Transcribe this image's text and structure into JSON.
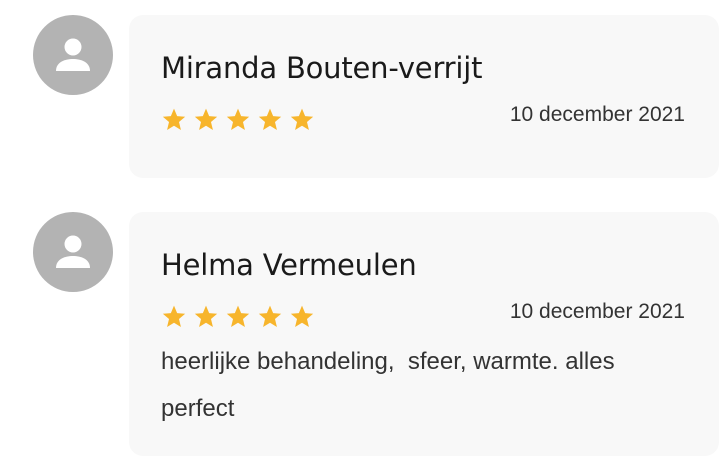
{
  "reviews": [
    {
      "author": "Miranda Bouten-verrijt",
      "rating": 5,
      "date": "10 december 2021",
      "text": "",
      "avatar_icon": "user-icon"
    },
    {
      "author": "Helma Vermeulen",
      "rating": 5,
      "date": "10 december 2021",
      "text": "heerlijke behandeling,  sfeer, warmte. alles perfect",
      "avatar_icon": "user-icon"
    }
  ],
  "colors": {
    "star": "#f7b52c",
    "avatar_bg": "#b3b3b3",
    "card_bg": "#f8f8f8"
  }
}
